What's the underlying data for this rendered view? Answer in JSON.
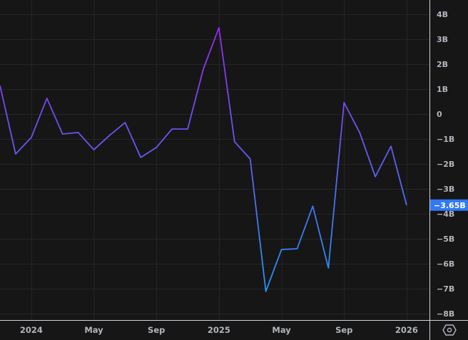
{
  "chart_data": {
    "type": "line",
    "title": "",
    "xlabel": "",
    "ylabel": "",
    "ylim": [
      -8.6,
      4.6
    ],
    "yticks": [
      4,
      3,
      2,
      1,
      0,
      -1,
      -2,
      -3,
      -4,
      -5,
      -6,
      -7,
      -8
    ],
    "ytick_labels": [
      "4B",
      "3B",
      "2B",
      "1B",
      "0",
      "−1B",
      "−2B",
      "−3B",
      "−4B",
      "−5B",
      "−6B",
      "−7B",
      "−8B"
    ],
    "x": [
      "2023-11",
      "2023-12",
      "2024-01",
      "2024-02",
      "2024-03",
      "2024-04",
      "2024-05",
      "2024-06",
      "2024-07",
      "2024-08",
      "2024-09",
      "2024-10",
      "2024-11",
      "2024-12",
      "2025-01",
      "2025-02",
      "2025-03",
      "2025-04",
      "2025-05",
      "2025-06",
      "2025-07",
      "2025-08",
      "2025-09",
      "2025-10",
      "2025-11",
      "2025-12",
      "2026-01"
    ],
    "values": [
      1.14,
      -1.6,
      -0.94,
      0.63,
      -0.8,
      -0.74,
      -1.43,
      -0.86,
      -0.34,
      -1.74,
      -1.34,
      -0.6,
      -0.6,
      1.8,
      3.46,
      -1.11,
      -1.8,
      -7.11,
      -5.43,
      -5.4,
      -3.69,
      -6.17,
      0.46,
      -0.74,
      -2.51,
      -1.29,
      -3.65
    ],
    "xtick_labels": [
      {
        "label": "2024",
        "index": 2
      },
      {
        "label": "May",
        "index": 6
      },
      {
        "label": "Sep",
        "index": 10
      },
      {
        "label": "2025",
        "index": 14
      },
      {
        "label": "May",
        "index": 18
      },
      {
        "label": "Sep",
        "index": 22
      },
      {
        "label": "2026",
        "index": 26
      }
    ],
    "last_value_label": "−3.65B",
    "grid": true,
    "units": "B"
  },
  "colors": {
    "line_top": "#9c27f0",
    "line_bottom": "#2196f3",
    "last_label_bg": "#3179f5",
    "grid": "#262626",
    "axis": "#d1d4dc"
  },
  "settings_icon": "gear-icon"
}
